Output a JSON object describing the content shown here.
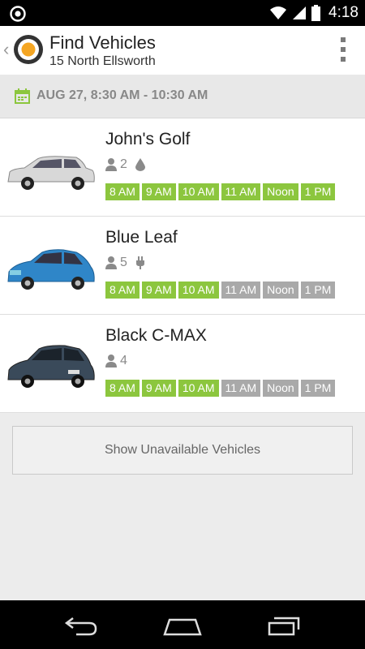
{
  "status_bar": {
    "time": "4:18",
    "icons": [
      "target-icon",
      "wifi-icon",
      "signal-icon",
      "battery-icon"
    ]
  },
  "app_bar": {
    "title": "Find Vehicles",
    "subtitle": "15 North Ellsworth",
    "back_icon": "chevron-left-icon",
    "logo_icon": "app-logo-icon",
    "menu_icon": "overflow-menu-icon"
  },
  "reservation": {
    "icon": "calendar-icon",
    "datetime": "AUG 27, 8:30 AM - 10:30 AM"
  },
  "colors": {
    "available": "#8cc63e",
    "unavailable": "#a9a9a9",
    "brand_orange": "#f5a623"
  },
  "vehicles": [
    {
      "name": "John's Golf",
      "seats": "2",
      "fuel_icon": "gas-drop-icon",
      "car_color": "#d8d8d8",
      "slots": [
        {
          "label": "8 AM",
          "available": true
        },
        {
          "label": "9 AM",
          "available": true
        },
        {
          "label": "10 AM",
          "available": true
        },
        {
          "label": "11 AM",
          "available": true
        },
        {
          "label": "Noon",
          "available": true
        },
        {
          "label": "1 PM",
          "available": true
        }
      ]
    },
    {
      "name": "Blue Leaf",
      "seats": "5",
      "fuel_icon": "electric-plug-icon",
      "car_color": "#2f86c8",
      "slots": [
        {
          "label": "8 AM",
          "available": true
        },
        {
          "label": "9 AM",
          "available": true
        },
        {
          "label": "10 AM",
          "available": true
        },
        {
          "label": "11 AM",
          "available": false
        },
        {
          "label": "Noon",
          "available": false
        },
        {
          "label": "1 PM",
          "available": false
        }
      ]
    },
    {
      "name": "Black C-MAX",
      "seats": "4",
      "fuel_icon": "",
      "car_color": "#3a4a5a",
      "slots": [
        {
          "label": "8 AM",
          "available": true
        },
        {
          "label": "9 AM",
          "available": true
        },
        {
          "label": "10 AM",
          "available": true
        },
        {
          "label": "11 AM",
          "available": false
        },
        {
          "label": "Noon",
          "available": false
        },
        {
          "label": "1 PM",
          "available": false
        }
      ]
    }
  ],
  "show_unavailable_label": "Show Unavailable Vehicles",
  "nav_bar": {
    "icons": [
      "back-nav-icon",
      "home-nav-icon",
      "recents-nav-icon"
    ]
  }
}
